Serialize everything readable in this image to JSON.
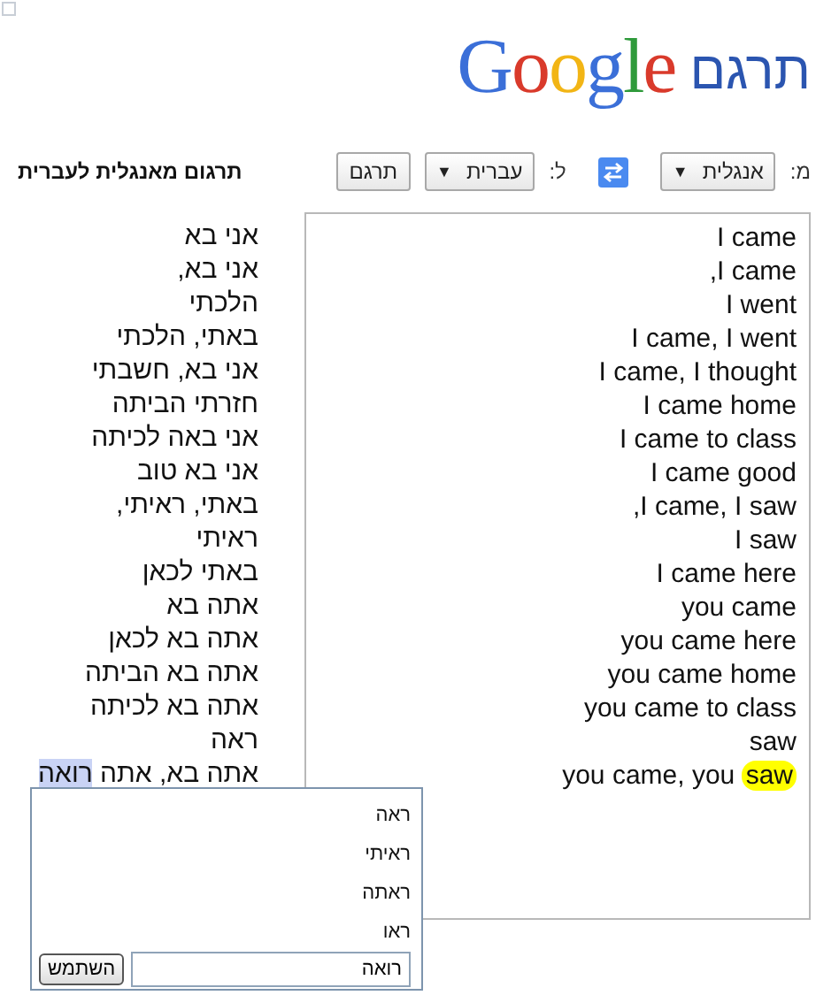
{
  "header": {
    "title": "תרגם",
    "logo": "Google"
  },
  "toolbar": {
    "from_label": "מ:",
    "from_language": {
      "value": "אנגלית",
      "arrow": "▼"
    },
    "to_label": "ל:",
    "to_language": {
      "value": "עברית",
      "arrow": "▼"
    },
    "translate_button": "תרגם",
    "heading": "תרגום מאנגלית לעברית"
  },
  "source_lines": [
    {
      "text": "I came"
    },
    {
      "text": ",I came"
    },
    {
      "text": "I went"
    },
    {
      "text": "I came, I went"
    },
    {
      "text": "I came, I thought"
    },
    {
      "text": "I came home"
    },
    {
      "text": "I came to class"
    },
    {
      "text": "I came good"
    },
    {
      "text": ",I came, I saw"
    },
    {
      "text": "I saw"
    },
    {
      "text": "I came here"
    },
    {
      "text": "you came"
    },
    {
      "text": "you came here"
    },
    {
      "text": "you came home"
    },
    {
      "text": "you came to class"
    },
    {
      "text": "saw"
    },
    {
      "text": "you came, you ",
      "highlight": "saw"
    }
  ],
  "translation_lines": [
    {
      "text": "אני בא"
    },
    {
      "text": "אני בא,"
    },
    {
      "text": "הלכתי"
    },
    {
      "text": "באתי, הלכתי"
    },
    {
      "text": "אני בא, חשבתי"
    },
    {
      "text": "חזרתי הביתה"
    },
    {
      "text": "אני באה לכיתה"
    },
    {
      "text": "אני בא טוב"
    },
    {
      "text": "באתי, ראיתי,"
    },
    {
      "text": "ראיתי"
    },
    {
      "text": "באתי לכאן"
    },
    {
      "text": "אתה בא"
    },
    {
      "text": "אתה בא לכאן"
    },
    {
      "text": "אתה בא הביתה"
    },
    {
      "text": "אתה בא לכיתה"
    },
    {
      "text": "ראה"
    },
    {
      "text": "אתה בא, אתה ",
      "highlight": "רואה"
    }
  ],
  "alternatives_popup": {
    "options": [
      "ראה",
      "ראיתי",
      "ראתה",
      "ראו"
    ],
    "input": {
      "value": "רואה"
    },
    "use_button": "השתמש"
  }
}
